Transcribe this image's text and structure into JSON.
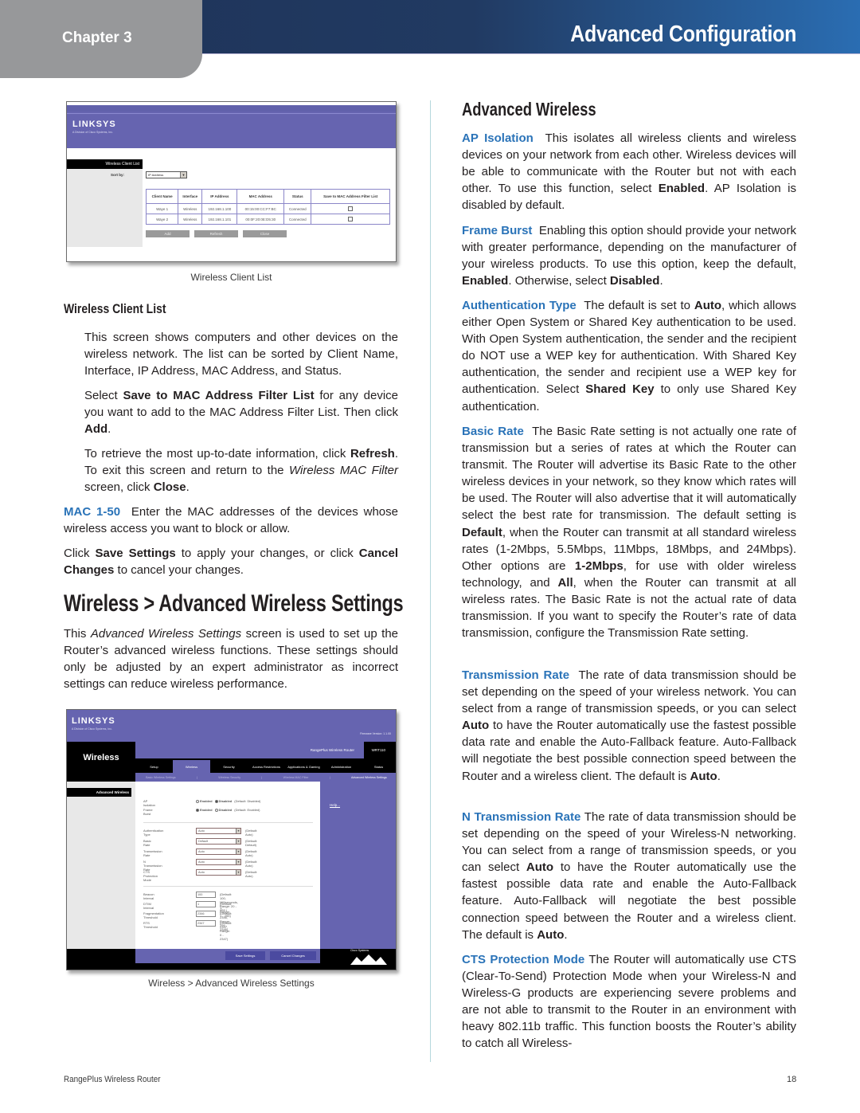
{
  "header": {
    "chapter": "Chapter 3",
    "title": "Advanced Configuration",
    "colors": {
      "bar_dark": "#1e3358",
      "bar_light": "#2a6db2",
      "chapter_tab": "#97989a",
      "term_blue": "#2a73b8"
    }
  },
  "left": {
    "shot1": {
      "logo": "LINKSYS",
      "logo_sub": "A Division of Cisco Systems, Inc.",
      "section": "Wireless Client List",
      "sort_label": "Sort by:",
      "sort_value": "IP Address",
      "columns": [
        "Client Name",
        "Interface",
        "IP Address",
        "MAC Address",
        "Status",
        "Save to MAC Address Filter List"
      ],
      "rows": [
        [
          "Waye 1",
          "Wireless",
          "192.168.1.100",
          "00:15:00:CC:F7:BC",
          "Connected",
          false
        ],
        [
          "Waye 2",
          "Wireless",
          "192.168.1.101",
          "00:0F:20:0E:D5:30",
          "Connected",
          false
        ]
      ],
      "buttons": {
        "add": "Add",
        "refresh": "Refresh",
        "close": "Close"
      },
      "caption": "Wireless Client List"
    },
    "subheading": "Wireless Client List",
    "p1": "This screen shows computers and other devices on the wireless network. The list can be sorted by Client Name, Interface, IP Address, MAC Address, and Status.",
    "p2": {
      "a": "Select ",
      "b1": "Save to MAC Address Filter List",
      "c": " for any device you want to add to the MAC Address Filter List. Then click ",
      "b2": "Add",
      "d": "."
    },
    "p3": {
      "a": "To retrieve the most up-to-date information, click ",
      "b1": "Refresh",
      "c": ". To exit this screen and return to the ",
      "i1": "Wireless MAC Filter",
      "d": " screen, click ",
      "b2": "Close",
      "e": "."
    },
    "p4": {
      "term": "MAC 1-50",
      "text": "  Enter the MAC addresses of the devices whose wireless access you want to block or allow."
    },
    "p5": {
      "a": "Click ",
      "b1": "Save Settings",
      "c": " to apply your changes, or click ",
      "b2": "Cancel Changes",
      "d": " to cancel your changes."
    },
    "heading": "Wireless > Advanced Wireless Settings",
    "p6": {
      "a": "This ",
      "i1": "Advanced Wireless Settings",
      "b": " screen is used to set up the Router’s advanced wireless functions. These settings should only be adjusted by an expert administrator as incorrect settings can reduce wireless performance."
    },
    "shot2": {
      "logo": "LINKSYS",
      "logo_sub": "A Division of Cisco Systems, Inc.",
      "firmware": "Firmware Version: 1.1.00",
      "page_title": "Wireless",
      "product": "RangePlus Wireless Router",
      "model": "WRT110",
      "tabs": [
        "Setup",
        "Wireless",
        "Security",
        "Access Restrictions",
        "Applications & Gaming",
        "Administration",
        "Status"
      ],
      "subtabs": [
        "Basic Wireless Settings",
        "Wireless Security",
        "Wireless MAC Filter",
        "Advanced Wireless Settings"
      ],
      "section": "Advanced Wireless",
      "help": "Help...",
      "radios": [
        {
          "label": "AP Isolation",
          "opt1": "Enabled",
          "opt2": "Disabled",
          "selected": "Disabled",
          "default": "(Default: Disabled)"
        },
        {
          "label": "Frame Burst",
          "opt1": "Enabled",
          "opt2": "Disabled",
          "selected": "Enabled",
          "default": "(Default: Enabled)"
        }
      ],
      "selects": [
        {
          "label": "Authentication Type",
          "value": "Auto",
          "default": "(Default: Auto)"
        },
        {
          "label": "Basic Rate",
          "value": "Default",
          "default": "(Default: Default)"
        },
        {
          "label": "Transmission Rate",
          "value": "Auto",
          "default": "(Default: Auto)"
        },
        {
          "label": "N Transmission Rate",
          "value": "Auto",
          "default": "(Default: Auto)"
        },
        {
          "label": "CTS Protection Mode",
          "value": "Auto",
          "default": "(Default: Auto)"
        }
      ],
      "inputs": [
        {
          "label": "Beacon Interval",
          "value": "100",
          "default": "(Default: 100, Milliseconds, Range: 20 - 999 )"
        },
        {
          "label": "DTIM Interval",
          "value": "1",
          "default": "(Default: 1, Range: 1 - 255)"
        },
        {
          "label": "Fragmentation Threshold",
          "value": "2346",
          "default": "(Default: 2346, Range: 256 - 2346)"
        },
        {
          "label": "RTS Threshold",
          "value": "2347",
          "default": "(Default: 2347, Range: 0 - 2347)"
        }
      ],
      "save": "Save Settings",
      "cancel": "Cancel Changes",
      "cisco": "Cisco Systems",
      "caption": "Wireless > Advanced Wireless Settings"
    }
  },
  "right": {
    "heading": "Advanced Wireless",
    "ap": {
      "term": "AP Isolation",
      "a": "  This isolates all wireless clients and wireless devices on your network from each other. Wireless devices will be able to communicate with the Router but not with each other. To use this function, select ",
      "b1": "Enabled",
      "c": ". AP Isolation is disabled by default."
    },
    "fb": {
      "term": "Frame Burst",
      "a": "  Enabling this option should provide your network with greater performance, depending on the manufacturer of your wireless products. To use this option, keep the default, ",
      "b1": "Enabled",
      "c": ". Otherwise, select ",
      "b2": "Disabled",
      "d": "."
    },
    "auth": {
      "term": "Authentication Type",
      "a": "  The default is set to ",
      "b1": "Auto",
      "c": ", which allows either Open System or Shared Key authentication to be used. With Open System authentication, the sender and the recipient do NOT use a WEP key for authentication. With Shared Key authentication, the sender and recipient use a WEP key for authentication. Select ",
      "b2": "Shared Key",
      "d": " to only use Shared Key authentication."
    },
    "basic": {
      "term": "Basic Rate",
      "a": "  The Basic Rate setting is not actually one rate of transmission but a series of rates at which the Router can transmit. The Router will advertise its Basic Rate to the other wireless devices in your network, so they know which rates will be used. The Router will also advertise that it will automatically select the best rate for transmission. The default setting is ",
      "b1": "Default",
      "c": ", when the Router can transmit at all standard wireless rates (1-2Mbps, 5.5Mbps, 11Mbps, 18Mbps, and 24Mbps). Other options are ",
      "b2": "1-2Mbps",
      "d": ", for use with older wireless technology, and ",
      "b3": "All",
      "e": ", when the Router can transmit at all wireless rates. The Basic Rate is not the actual rate of data transmission. If you want to specify the Router’s rate of data transmission, configure the Transmission Rate setting."
    },
    "tx": {
      "term": "Transmission Rate",
      "a": "  The rate of data transmission should be set depending on the speed of your wireless network. You can select from a range of transmission speeds, or you can select ",
      "b1": "Auto",
      "c": " to have the Router automatically use the fastest possible data rate and enable the Auto-Fallback feature. Auto-Fallback will negotiate the best possible connection speed between the Router and a wireless client. The default is ",
      "b2": "Auto",
      "d": "."
    },
    "ntx": {
      "term": "N Transmission Rate",
      "a": " The rate of data transmission should be set depending on the speed of your Wireless-N networking. You can select from a range of transmission speeds, or you can select ",
      "b1": "Auto",
      "c": " to have the Router automatically use the fastest possible data rate and enable the Auto-Fallback feature. Auto-Fallback will negotiate the best possible connection speed between the Router and a wireless client. The default is ",
      "b2": "Auto",
      "d": "."
    },
    "cts": {
      "term": "CTS Protection Mode",
      "a": " The Router will automatically use CTS (Clear-To-Send) Protection Mode when your Wireless-N and Wireless-G products are experiencing severe problems and are not able to transmit to the Router in an environment with heavy 802.11b traffic. This function boosts the Router’s ability to catch all Wireless-"
    }
  },
  "footer": {
    "product": "RangePlus Wireless Router",
    "page": "18"
  }
}
